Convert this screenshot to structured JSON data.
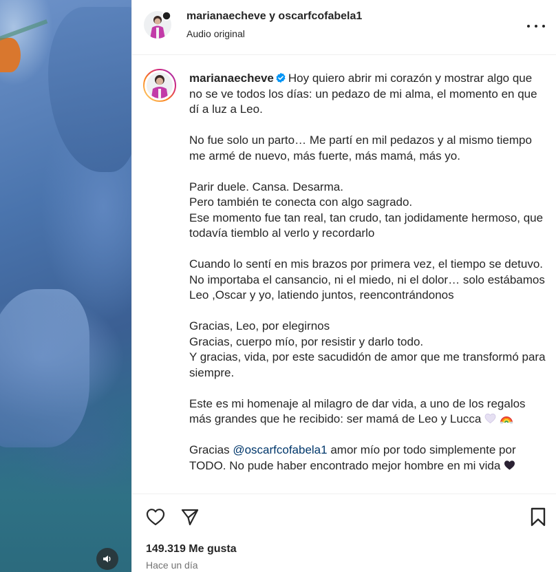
{
  "header": {
    "names": "marianaecheve y oscarfcofabela1",
    "audio": "Audio original"
  },
  "post": {
    "username": "marianaecheve",
    "first_line": "Hoy quiero abrir mi corazón y mostrar algo que no se ve todos los días: un pedazo de mi alma, el momento en que dí a luz a Leo.",
    "paragraphs": [
      "No fue solo un parto… Me partí en mil pedazos y al mismo tiempo me armé de nuevo, más fuerte, más mamá, más yo.",
      "Parir duele. Cansa. Desarma.\nPero también te conecta con algo sagrado.\nEse momento fue tan real, tan crudo, tan jodidamente hermoso, que todavía tiemblo al verlo y recordarlo",
      "Cuando lo sentí en mis brazos por primera vez, el tiempo se detuvo.\nNo importaba el cansancio, ni el miedo, ni el dolor… solo estábamos Leo ,Oscar y yo, latiendo juntos, reencontrándonos",
      "Gracias, Leo, por elegirnos\nGracias, cuerpo mío, por resistir y darlo todo.\nY gracias, vida, por este sacudidón de amor que me transformó para siempre."
    ],
    "homage": "Este es mi homenaje al milagro de dar vida, a uno de los regalos más grandes que he recibido: ser mamá de Leo y Lucca",
    "thanks_prefix": "Gracias",
    "mention": "@oscarfcofabela1",
    "thanks_rest": "amor mío por todo simplemente por TODO. No pude haber encontrado mejor hombre en mi vida"
  },
  "footer": {
    "likes": "149.319 Me gusta",
    "time": "Hace un día"
  },
  "colors": {
    "text": "#262626",
    "muted": "#737373",
    "verified": "#0095f6",
    "mention": "#00376b"
  },
  "icons": [
    "sound-icon",
    "more-icon",
    "verified-icon",
    "heart-icon",
    "share-icon",
    "bookmark-icon"
  ]
}
